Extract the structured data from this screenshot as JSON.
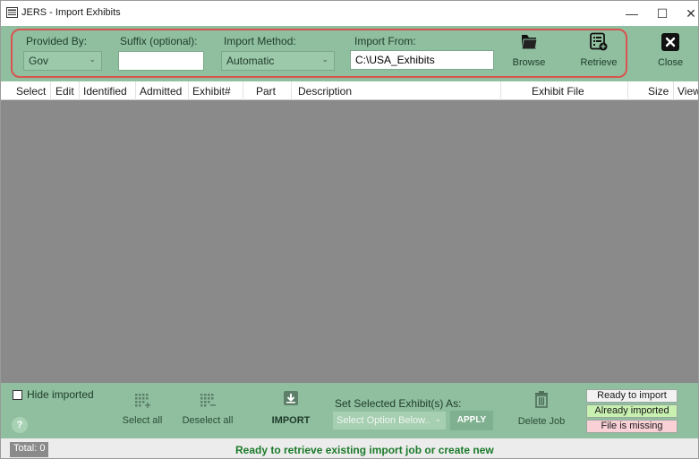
{
  "window": {
    "title": "JERS - Import Exhibits",
    "minimize": "—",
    "maximize": "☐",
    "close": "✕"
  },
  "toolbar": {
    "provided_by": {
      "label": "Provided By:",
      "value": "Gov"
    },
    "suffix": {
      "label": "Suffix (optional):",
      "value": ""
    },
    "import_method": {
      "label": "Import Method:",
      "value": "Automatic"
    },
    "import_from": {
      "label": "Import From:",
      "value": "C:\\USA_Exhibits"
    },
    "browse_label": "Browse",
    "retrieve_label": "Retrieve",
    "close_label": "Close"
  },
  "columns": [
    "Select",
    "Edit",
    "Identified",
    "Admitted",
    "Exhibit#",
    "Part",
    "Description",
    "Exhibit File",
    "Size",
    "View"
  ],
  "bottom": {
    "hide_imported_label": "Hide imported",
    "help_label": "?",
    "select_all_label": "Select all",
    "deselect_all_label": "Deselect all",
    "import_label": "IMPORT",
    "set_selected_label": "Set Selected Exhibit(s) As:",
    "option_placeholder": "Select Option Below..",
    "apply_label": "APPLY",
    "delete_job_label": "Delete Job",
    "legend": [
      {
        "label": "Ready to import",
        "color": "#f2f2f2"
      },
      {
        "label": "Already imported",
        "color": "#c8f0b0"
      },
      {
        "label": "File is missing",
        "color": "#f9d0d6"
      }
    ]
  },
  "status": {
    "total": "Total: 0",
    "message": "Ready to retrieve existing import job or create new"
  },
  "colors": {
    "accent": "#8fbf9f",
    "highlight_outline": "#d9534f",
    "status_text": "#1b7a2a"
  }
}
